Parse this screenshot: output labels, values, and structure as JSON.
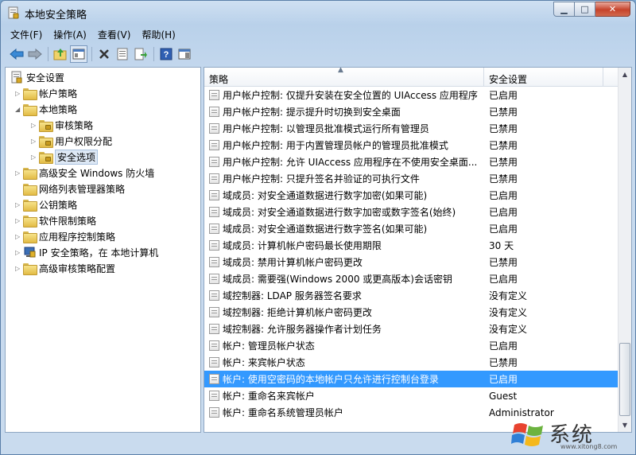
{
  "window": {
    "title": "本地安全策略"
  },
  "menu": {
    "items": [
      "文件(F)",
      "操作(A)",
      "查看(V)",
      "帮助(H)"
    ]
  },
  "toolbar": {
    "icons": [
      "back-arrow",
      "forward-arrow",
      "up-folder",
      "show-hide-tree",
      "delete",
      "properties",
      "export-list",
      "help",
      "show-hide-action-pane"
    ]
  },
  "tree": {
    "root": "安全设置",
    "items": [
      "帐户策略",
      "本地策略",
      "审核策略",
      "用户权限分配",
      "安全选项",
      "高级安全 Windows 防火墙",
      "网络列表管理器策略",
      "公钥策略",
      "软件限制策略",
      "应用程序控制策略",
      "IP 安全策略，在 本地计算机",
      "高级审核策略配置"
    ],
    "selected": "安全选项"
  },
  "list": {
    "columns": {
      "policy": "策略",
      "setting": "安全设置"
    },
    "rows": [
      {
        "policy": "用户帐户控制: 仅提升安装在安全位置的 UIAccess 应用程序",
        "setting": "已启用"
      },
      {
        "policy": "用户帐户控制: 提示提升时切换到安全桌面",
        "setting": "已禁用"
      },
      {
        "policy": "用户帐户控制: 以管理员批准模式运行所有管理员",
        "setting": "已禁用"
      },
      {
        "policy": "用户帐户控制: 用于内置管理员帐户的管理员批准模式",
        "setting": "已禁用"
      },
      {
        "policy": "用户帐户控制: 允许 UIAccess 应用程序在不使用安全桌面...",
        "setting": "已禁用"
      },
      {
        "policy": "用户帐户控制: 只提升签名并验证的可执行文件",
        "setting": "已禁用"
      },
      {
        "policy": "域成员: 对安全通道数据进行数字加密(如果可能)",
        "setting": "已启用"
      },
      {
        "policy": "域成员: 对安全通道数据进行数字加密或数字签名(始终)",
        "setting": "已启用"
      },
      {
        "policy": "域成员: 对安全通道数据进行数字签名(如果可能)",
        "setting": "已启用"
      },
      {
        "policy": "域成员: 计算机帐户密码最长使用期限",
        "setting": "30 天"
      },
      {
        "policy": "域成员: 禁用计算机帐户密码更改",
        "setting": "已禁用"
      },
      {
        "policy": "域成员: 需要强(Windows 2000 或更高版本)会话密钥",
        "setting": "已启用"
      },
      {
        "policy": "域控制器: LDAP 服务器签名要求",
        "setting": "没有定义"
      },
      {
        "policy": "域控制器: 拒绝计算机帐户密码更改",
        "setting": "没有定义"
      },
      {
        "policy": "域控制器: 允许服务器操作者计划任务",
        "setting": "没有定义"
      },
      {
        "policy": "帐户: 管理员帐户状态",
        "setting": "已启用"
      },
      {
        "policy": "帐户: 来宾帐户状态",
        "setting": "已禁用"
      },
      {
        "policy": "帐户: 使用空密码的本地帐户只允许进行控制台登录",
        "setting": "已启用"
      },
      {
        "policy": "帐户: 重命名来宾帐户",
        "setting": "Guest"
      },
      {
        "policy": "帐户: 重命名系统管理员帐户",
        "setting": "Administrator"
      }
    ],
    "selected_index": 17
  },
  "watermark": {
    "text": "系统",
    "url": "www.xitong8.com"
  },
  "colors": {
    "selection": "#3399ff",
    "title_bar": "#b9d1ea"
  }
}
